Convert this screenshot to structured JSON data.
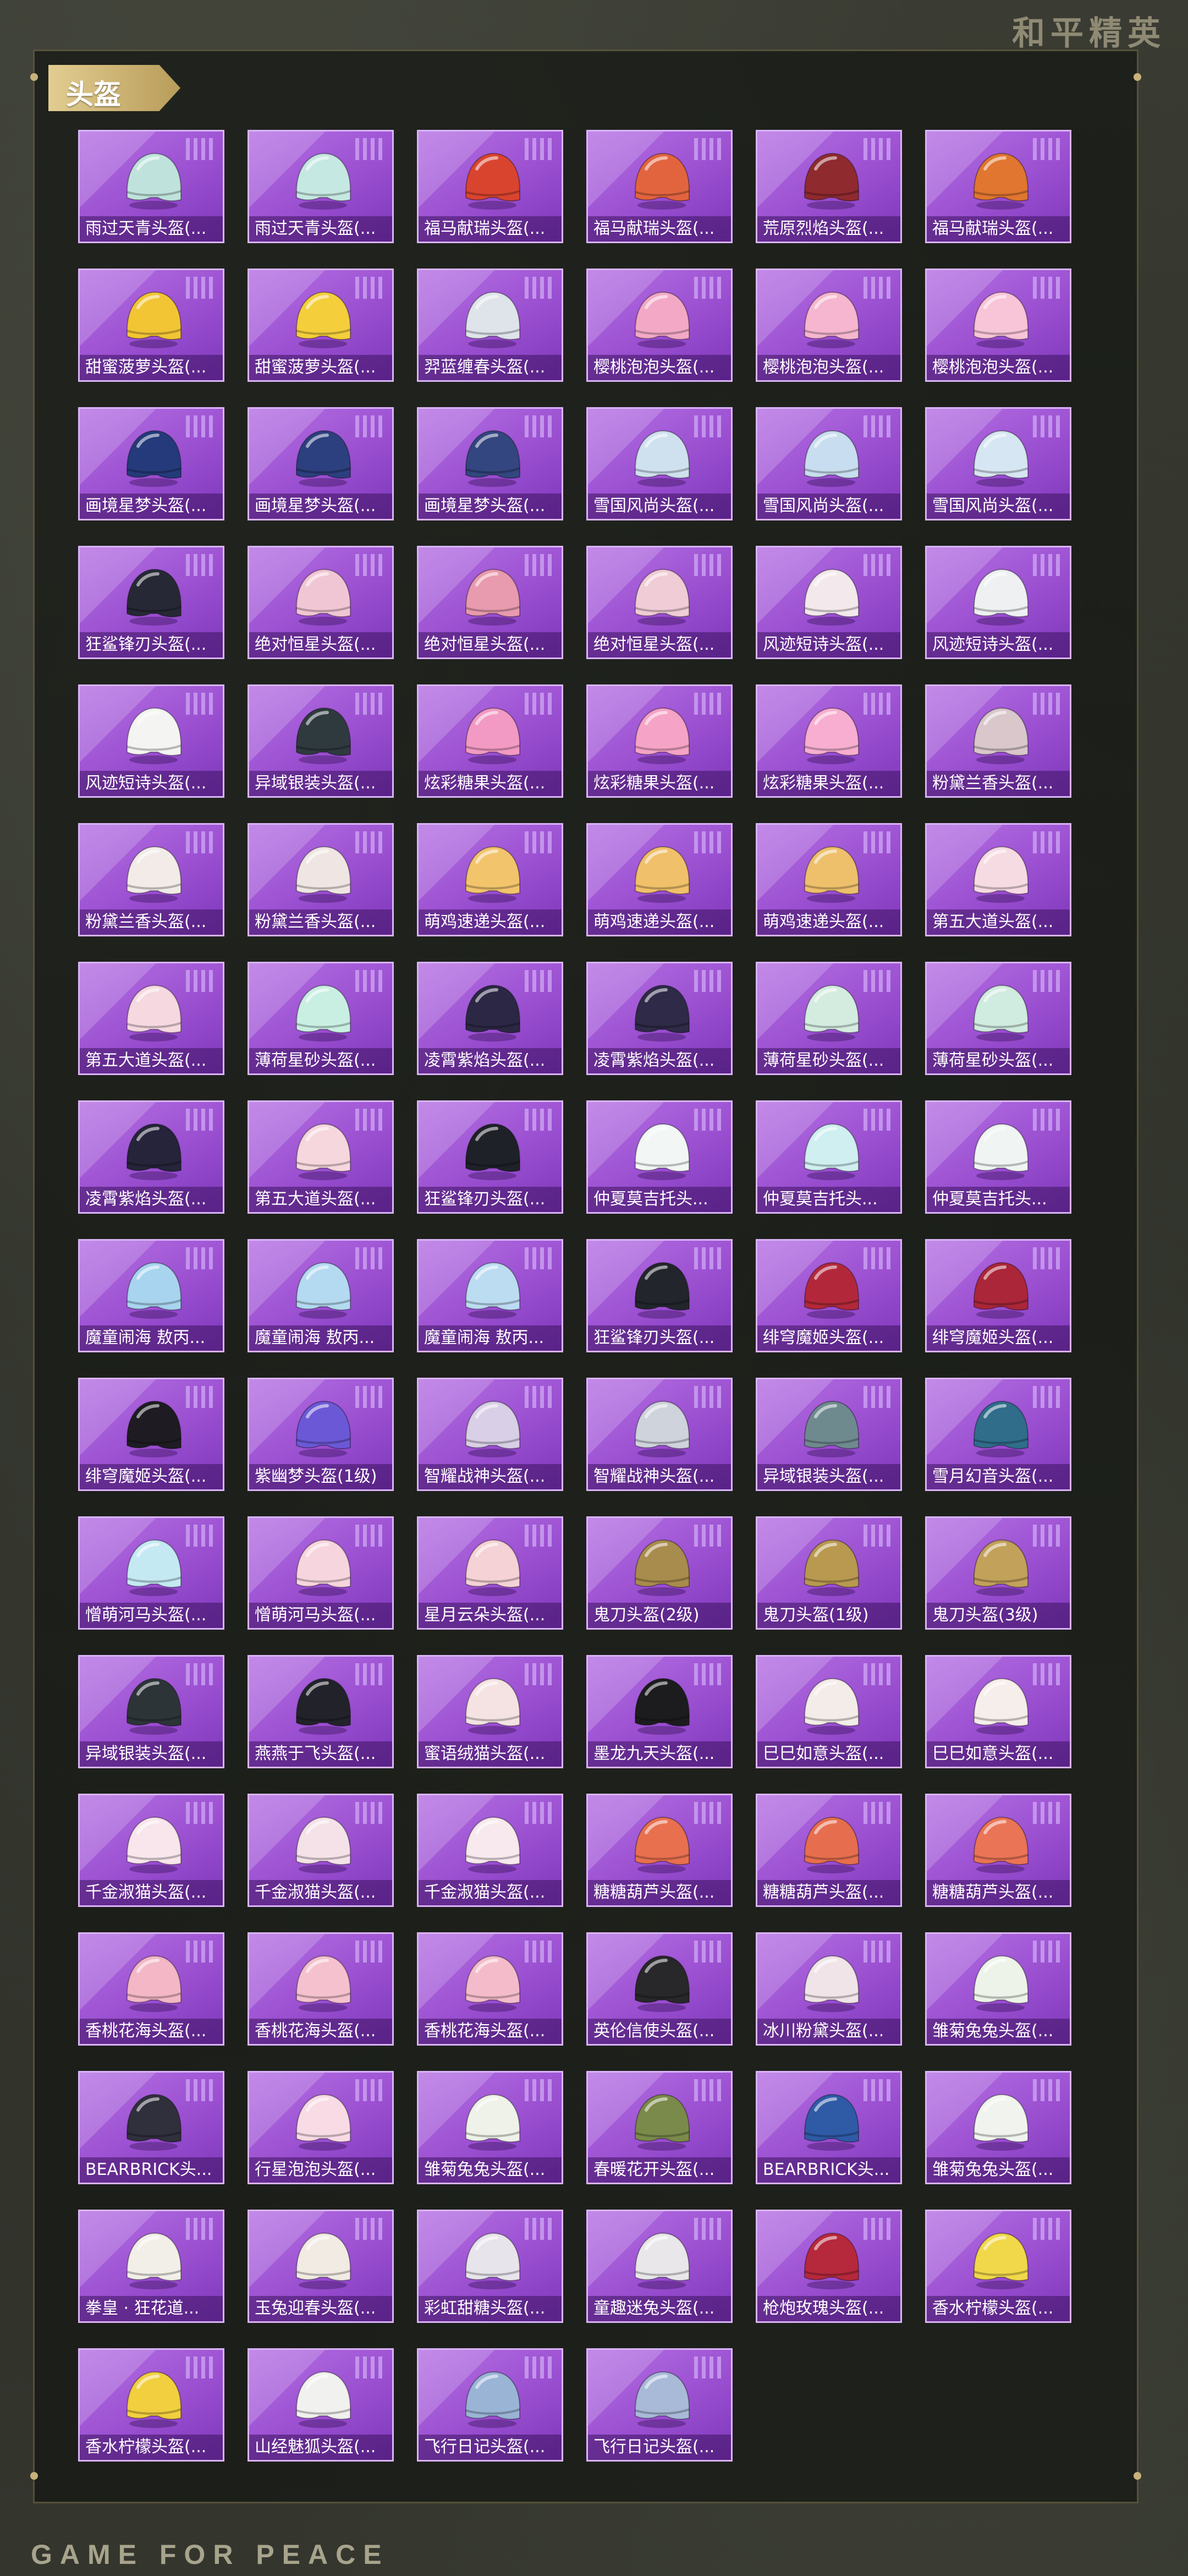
{
  "brand": "和平精英",
  "section_title": "头盔",
  "footer_text": "GAME FOR PEACE",
  "colors": {
    "card_purple": "#9a4fd0",
    "gold": "#c8b27a"
  },
  "items": [
    {
      "label": "雨过天青头盔(...",
      "color": "#bfe3dc"
    },
    {
      "label": "雨过天青头盔(...",
      "color": "#c6e8e2"
    },
    {
      "label": "福马献瑞头盔(...",
      "color": "#d9442f"
    },
    {
      "label": "福马献瑞头盔(...",
      "color": "#e2643f"
    },
    {
      "label": "荒原烈焰头盔(...",
      "color": "#8f2a2f"
    },
    {
      "label": "福马献瑞头盔(...",
      "color": "#e0762f"
    },
    {
      "label": "甜蜜菠萝头盔(...",
      "color": "#f2c534"
    },
    {
      "label": "甜蜜菠萝头盔(...",
      "color": "#f4cf3b"
    },
    {
      "label": "羿蓝缠春头盔(...",
      "color": "#dfe3ea"
    },
    {
      "label": "樱桃泡泡头盔(...",
      "color": "#f3a9c6"
    },
    {
      "label": "樱桃泡泡头盔(...",
      "color": "#f6b6cf"
    },
    {
      "label": "樱桃泡泡头盔(...",
      "color": "#f8c4d8"
    },
    {
      "label": "画境星梦头盔(...",
      "color": "#243a7a"
    },
    {
      "label": "画境星梦头盔(...",
      "color": "#2c3f7e"
    },
    {
      "label": "画境星梦头盔(...",
      "color": "#33467f"
    },
    {
      "label": "雪国风尚头盔(...",
      "color": "#cfe1ef"
    },
    {
      "label": "雪国风尚头盔(...",
      "color": "#c8ddef"
    },
    {
      "label": "雪国风尚头盔(...",
      "color": "#d6e6f2"
    },
    {
      "label": "狂鲨锋刃头盔(...",
      "color": "#262935"
    },
    {
      "label": "绝对恒星头盔(...",
      "color": "#f1c6d4"
    },
    {
      "label": "绝对恒星头盔(...",
      "color": "#e89aae"
    },
    {
      "label": "绝对恒星头盔(...",
      "color": "#f0ccd6"
    },
    {
      "label": "风迹短诗头盔(...",
      "color": "#f3e9ec"
    },
    {
      "label": "风迹短诗头盔(...",
      "color": "#eef0f2"
    },
    {
      "label": "风迹短诗头盔(...",
      "color": "#f4f4f2"
    },
    {
      "label": "异域银装头盔(...",
      "color": "#2f3a3f"
    },
    {
      "label": "炫彩糖果头盔(...",
      "color": "#f29ac3"
    },
    {
      "label": "炫彩糖果头盔(...",
      "color": "#f5a3c6"
    },
    {
      "label": "炫彩糖果头盔(...",
      "color": "#f7aed0"
    },
    {
      "label": "粉黛兰香头盔(...",
      "color": "#d9c7cc"
    },
    {
      "label": "粉黛兰香头盔(...",
      "color": "#f2ebe8"
    },
    {
      "label": "粉黛兰香头盔(...",
      "color": "#efe6e3"
    },
    {
      "label": "萌鸡速递头盔(...",
      "color": "#f2c46c"
    },
    {
      "label": "萌鸡速递头盔(...",
      "color": "#f0c06a"
    },
    {
      "label": "萌鸡速递头盔(...",
      "color": "#eec06c"
    },
    {
      "label": "第五大道头盔(...",
      "color": "#f7dbe3"
    },
    {
      "label": "第五大道头盔(...",
      "color": "#f5d8e0"
    },
    {
      "label": "薄荷星砂头盔(...",
      "color": "#c9efe3"
    },
    {
      "label": "凌霄紫焰头盔(...",
      "color": "#2c2745"
    },
    {
      "label": "凌霄紫焰头盔(...",
      "color": "#2e2a47"
    },
    {
      "label": "薄荷星砂头盔(...",
      "color": "#d4ece0"
    },
    {
      "label": "薄荷星砂头盔(...",
      "color": "#d0ebdf"
    },
    {
      "label": "凌霄紫焰头盔(...",
      "color": "#25243a"
    },
    {
      "label": "第五大道头盔(...",
      "color": "#f6d7de"
    },
    {
      "label": "狂鲨锋刃头盔(...",
      "color": "#1f2128"
    },
    {
      "label": "仲夏莫吉托头...",
      "color": "#f2f6f4"
    },
    {
      "label": "仲夏莫吉托头...",
      "color": "#cfeff0"
    },
    {
      "label": "仲夏莫吉托头...",
      "color": "#f0f4f3"
    },
    {
      "label": "魔童闹海 敖丙...",
      "color": "#a8d4ef"
    },
    {
      "label": "魔童闹海 敖丙...",
      "color": "#b3daf0"
    },
    {
      "label": "魔童闹海 敖丙...",
      "color": "#bcdcf2"
    },
    {
      "label": "狂鲨锋刃头盔(...",
      "color": "#23252c"
    },
    {
      "label": "绯穹魔姬头盔(...",
      "color": "#b2283a"
    },
    {
      "label": "绯穹魔姬头盔(...",
      "color": "#aa2638"
    },
    {
      "label": "绯穹魔姬头盔(...",
      "color": "#1e1c22"
    },
    {
      "label": "紫幽梦头盔(1级)",
      "color": "#6b58d6"
    },
    {
      "label": "智耀战神头盔(...",
      "color": "#d9cfe6"
    },
    {
      "label": "智耀战神头盔(...",
      "color": "#cfd3dc"
    },
    {
      "label": "异域银装头盔(...",
      "color": "#6f8a8f"
    },
    {
      "label": "雪月幻音头盔(...",
      "color": "#2f6d8a"
    },
    {
      "label": "憎萌河马头盔(...",
      "color": "#c5e9f3"
    },
    {
      "label": "憎萌河马头盔(...",
      "color": "#f7d5de"
    },
    {
      "label": "星月云朵头盔(...",
      "color": "#f4d2d6"
    },
    {
      "label": "鬼刀头盔(2级)",
      "color": "#a88c4d"
    },
    {
      "label": "鬼刀头盔(1级)",
      "color": "#b8994f"
    },
    {
      "label": "鬼刀头盔(3级)",
      "color": "#c2a15a"
    },
    {
      "label": "异域银装头盔(...",
      "color": "#2c3438"
    },
    {
      "label": "燕燕于飞头盔(...",
      "color": "#22232a"
    },
    {
      "label": "蜜语绒猫头盔(...",
      "color": "#f5e3e3"
    },
    {
      "label": "墨龙九天头盔(...",
      "color": "#1c1c1e"
    },
    {
      "label": "巳巳如意头盔(...",
      "color": "#f3ece8"
    },
    {
      "label": "巳巳如意头盔(...",
      "color": "#f6eeea"
    },
    {
      "label": "千金淑猫头盔(...",
      "color": "#f8e6ec"
    },
    {
      "label": "千金淑猫头盔(...",
      "color": "#f5e2e8"
    },
    {
      "label": "千金淑猫头盔(...",
      "color": "#f7e9ee"
    },
    {
      "label": "糖糖葫芦头盔(...",
      "color": "#e8704f"
    },
    {
      "label": "糖糖葫芦头盔(...",
      "color": "#e66e4e"
    },
    {
      "label": "糖糖葫芦头盔(...",
      "color": "#ea7456"
    },
    {
      "label": "香桃花海头盔(...",
      "color": "#f3b7c6"
    },
    {
      "label": "香桃花海头盔(...",
      "color": "#f5c1ce"
    },
    {
      "label": "香桃花海头盔(...",
      "color": "#f4bccb"
    },
    {
      "label": "英伦信使头盔(...",
      "color": "#28272a"
    },
    {
      "label": "冰川粉黛头盔(...",
      "color": "#f1e4e8"
    },
    {
      "label": "雏菊兔兔头盔(...",
      "color": "#eef3ea"
    },
    {
      "label": "BEARBRICK头...",
      "color": "#302f3c"
    },
    {
      "label": "行星泡泡头盔(...",
      "color": "#f8dbe4"
    },
    {
      "label": "雏菊兔兔头盔(...",
      "color": "#eef2e8"
    },
    {
      "label": "春暖花开头盔(...",
      "color": "#7a8a4a"
    },
    {
      "label": "BEARBRICK头...",
      "color": "#2f5aa6"
    },
    {
      "label": "雏菊兔兔头盔(...",
      "color": "#f1f4ee"
    },
    {
      "label": "拳皇 · 狂花道...",
      "color": "#f2efe8"
    },
    {
      "label": "玉兔迎春头盔(...",
      "color": "#f1ebe4"
    },
    {
      "label": "彩虹甜糖头盔(...",
      "color": "#e8e4ec"
    },
    {
      "label": "童趣迷兔头盔(...",
      "color": "#e9e7ea"
    },
    {
      "label": "枪炮玫瑰头盔(...",
      "color": "#b6283c"
    },
    {
      "label": "香水柠檬头盔(...",
      "color": "#f0d84a"
    },
    {
      "label": "香水柠檬头盔(...",
      "color": "#f2cf3e"
    },
    {
      "label": "山经魅狐头盔(...",
      "color": "#f1f1ef"
    },
    {
      "label": "飞行日记头盔(...",
      "color": "#9ab4d6"
    },
    {
      "label": "飞行日记头盔(...",
      "color": "#a9bad8"
    }
  ]
}
